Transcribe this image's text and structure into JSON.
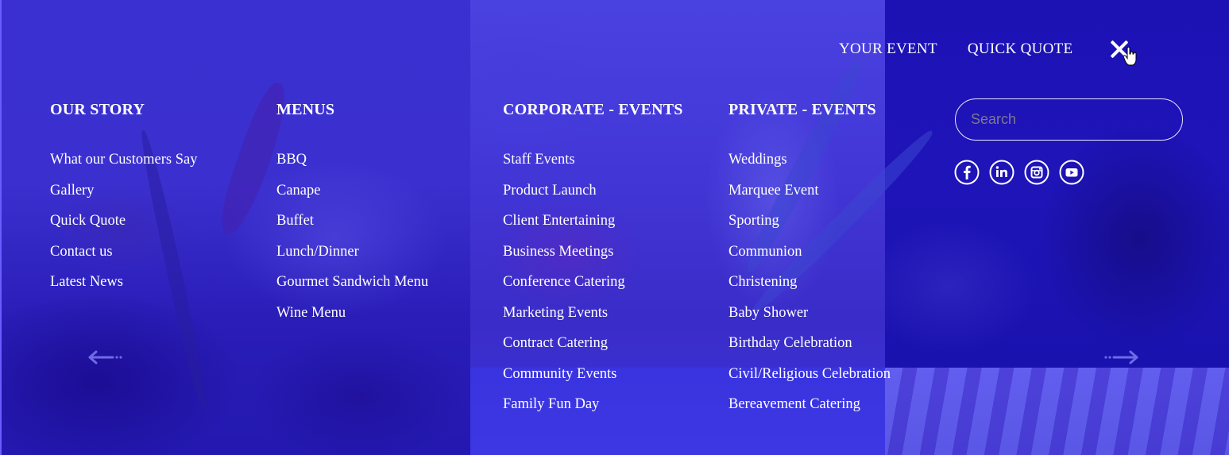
{
  "top_nav": {
    "links": [
      {
        "label": "YOUR EVENT"
      },
      {
        "label": "QUICK QUOTE"
      }
    ],
    "close_icon": "close-icon"
  },
  "columns": [
    {
      "heading": "OUR STORY",
      "items": [
        "What our Customers Say",
        "Gallery",
        "Quick Quote",
        "Contact us",
        "Latest News"
      ]
    },
    {
      "heading": "MENUS",
      "items": [
        "BBQ",
        "Canape",
        "Buffet",
        "Lunch/Dinner",
        "Gourmet Sandwich Menu",
        "Wine Menu"
      ]
    },
    {
      "heading": "CORPORATE - EVENTS",
      "items": [
        "Staff Events",
        "Product Launch",
        "Client Entertaining",
        "Business Meetings",
        "Conference Catering",
        "Marketing Events",
        "Contract Catering",
        "Community Events",
        "Family Fun Day"
      ]
    },
    {
      "heading": "PRIVATE - EVENTS",
      "items": [
        "Weddings",
        "Marquee Event",
        "Sporting",
        "Communion",
        "Christening",
        "Baby Shower",
        "Birthday Celebration",
        "Civil/Religious Celebration",
        "Bereavement Catering"
      ]
    }
  ],
  "search": {
    "placeholder": "Search",
    "value": ""
  },
  "social": [
    {
      "name": "facebook",
      "icon": "facebook-icon"
    },
    {
      "name": "linkedin",
      "icon": "linkedin-icon"
    },
    {
      "name": "instagram",
      "icon": "instagram-icon"
    },
    {
      "name": "youtube",
      "icon": "youtube-icon"
    }
  ],
  "slider": {
    "prev_icon": "arrow-left-icon",
    "next_icon": "arrow-right-icon"
  },
  "colors": {
    "overlay": "#2a20c8",
    "text": "#ffffff",
    "placeholder": "#7d7890"
  }
}
